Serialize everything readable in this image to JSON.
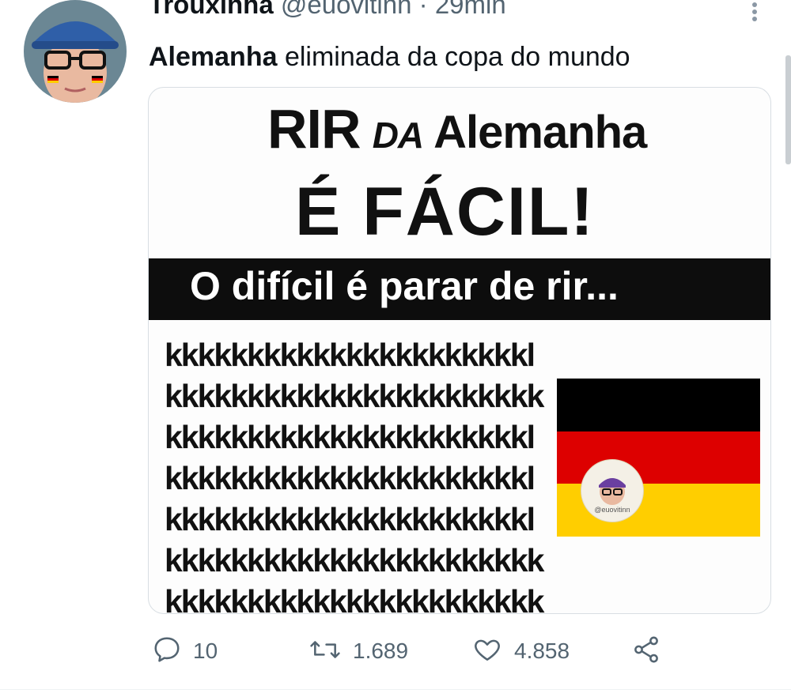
{
  "tweet": {
    "display_name": "Trouxinha",
    "handle": "@euovitinn",
    "separator": "·",
    "time": "29min",
    "text_bold": "Alemanha",
    "text_rest": " eliminada da copa do mundo"
  },
  "media": {
    "title_rir": "RIR",
    "title_da": "DA",
    "title_alemanha": "Alemanha",
    "title_line2": "É FÁCIL!",
    "band_text": "O difícil é parar de rir...",
    "laugh_lines": [
      "kkkkkkkkkkkkkkkkkkkkkkl",
      "kkkkkkkkkkkkkkkkkkkkkkk",
      "kkkkkkkkkkkkkkkkkkkkkkl",
      "kkkkkkkkkkkkkkkkkkkkkkl",
      "kkkkkkkkkkkkkkkkkkkkkkl",
      "kkkkkkkkkkkkkkkkkkkkkkk",
      "kkkkkkkkkkkkkkkkkkkkkkk"
    ],
    "flag_colors": [
      "#000000",
      "#dd0000",
      "#ffce00"
    ],
    "watermark_text": "@euovitinn"
  },
  "actions": {
    "replies": "10",
    "retweets": "1.689",
    "likes": "4.858"
  },
  "icons": {
    "reply": "reply-icon",
    "retweet": "retweet-icon",
    "like": "heart-icon",
    "share": "share-icon",
    "more": "more-vertical-icon"
  }
}
